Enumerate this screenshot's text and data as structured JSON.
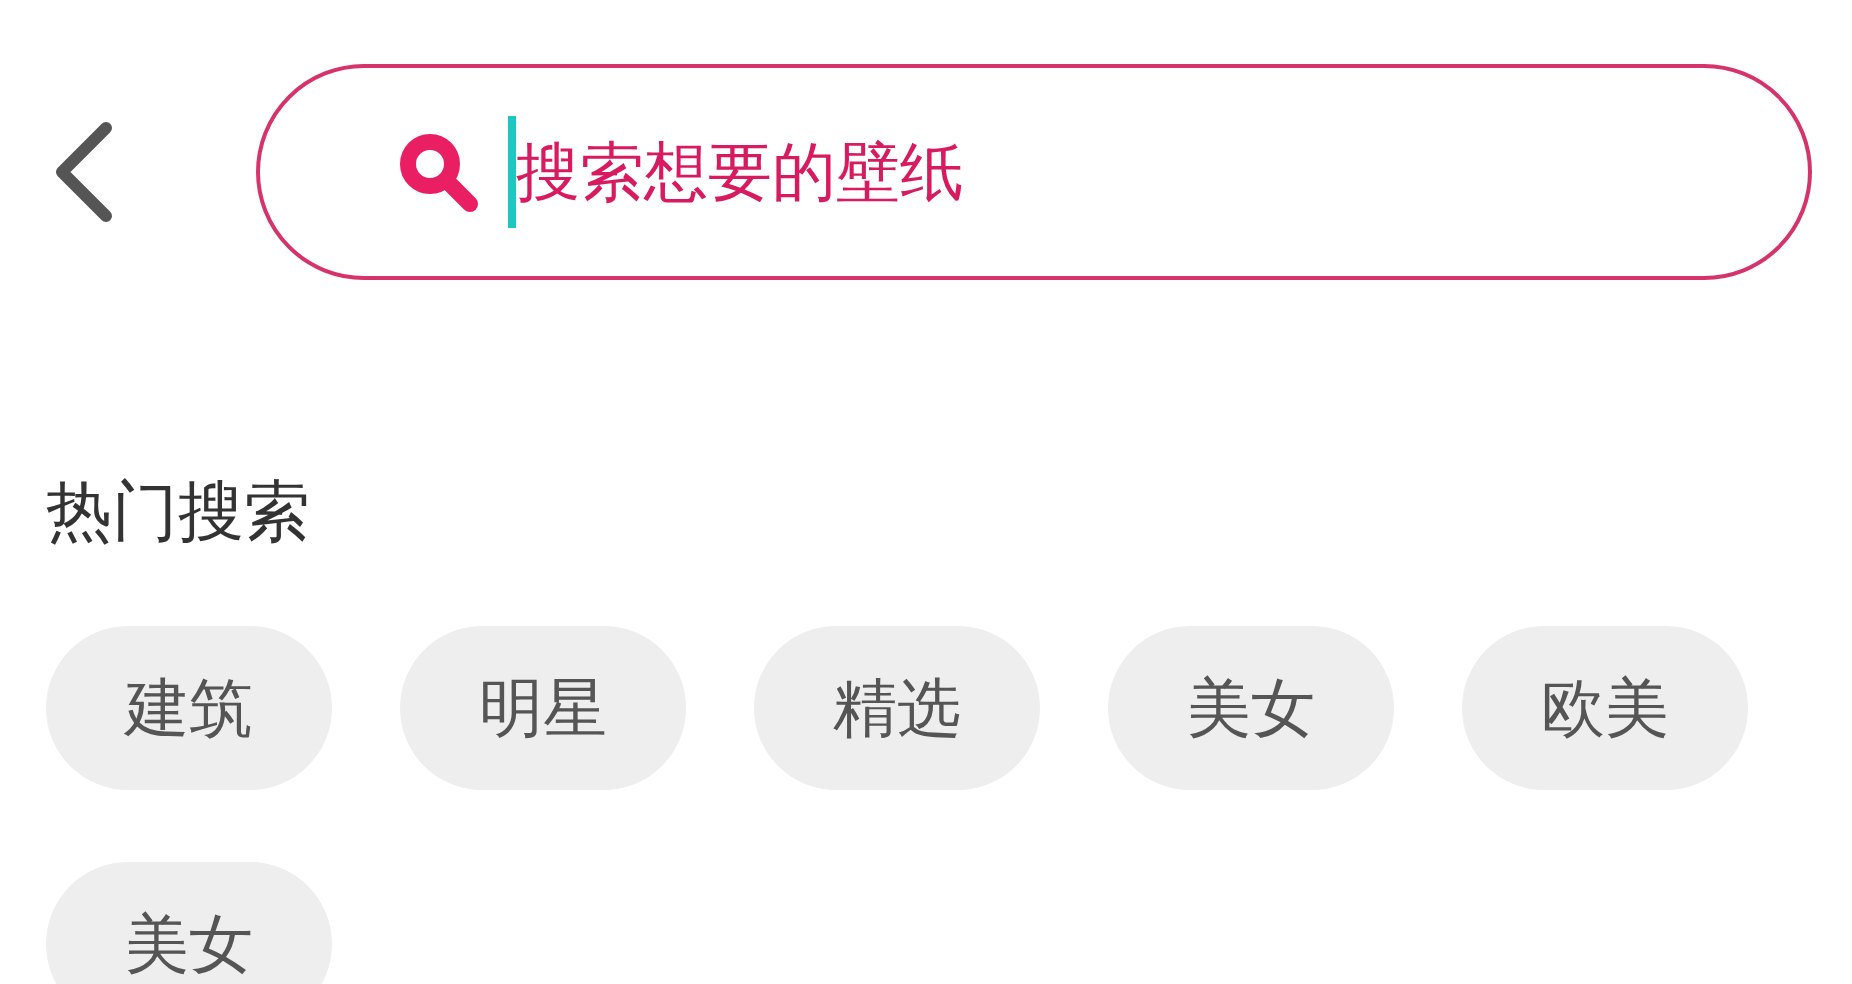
{
  "search": {
    "placeholder": "搜索想要的壁纸"
  },
  "hot_search": {
    "title": "热门搜索",
    "tags": [
      "建筑",
      "明星",
      "精选",
      "美女",
      "欧美",
      "美女"
    ]
  }
}
